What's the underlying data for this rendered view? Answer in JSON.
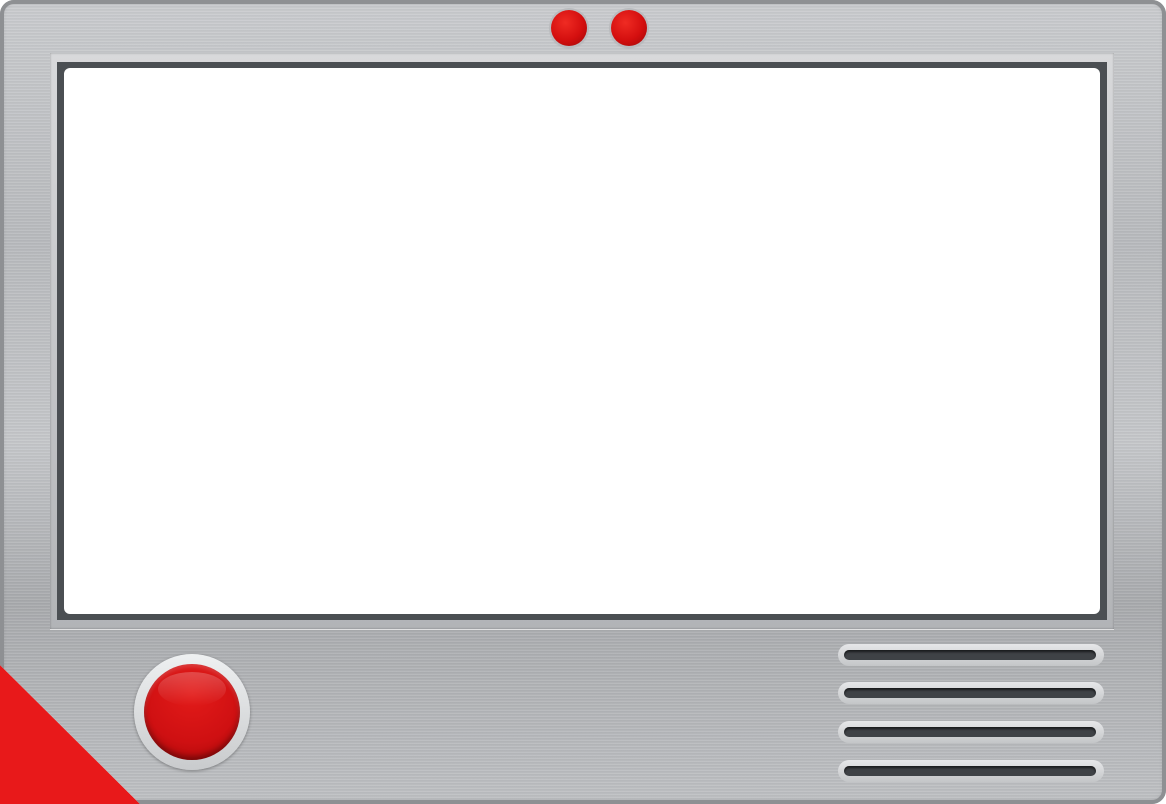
{
  "device": {
    "accent_color": "#d40f0f",
    "corner_color": "#e8191a",
    "body_color": "#bfc1c4",
    "screen_color": "#ffffff"
  },
  "icons": {
    "indicator_lights": [
      "red-led-icon",
      "red-led-icon"
    ],
    "home_button": "red-round-button-icon",
    "speaker": "speaker-grille-icon"
  }
}
